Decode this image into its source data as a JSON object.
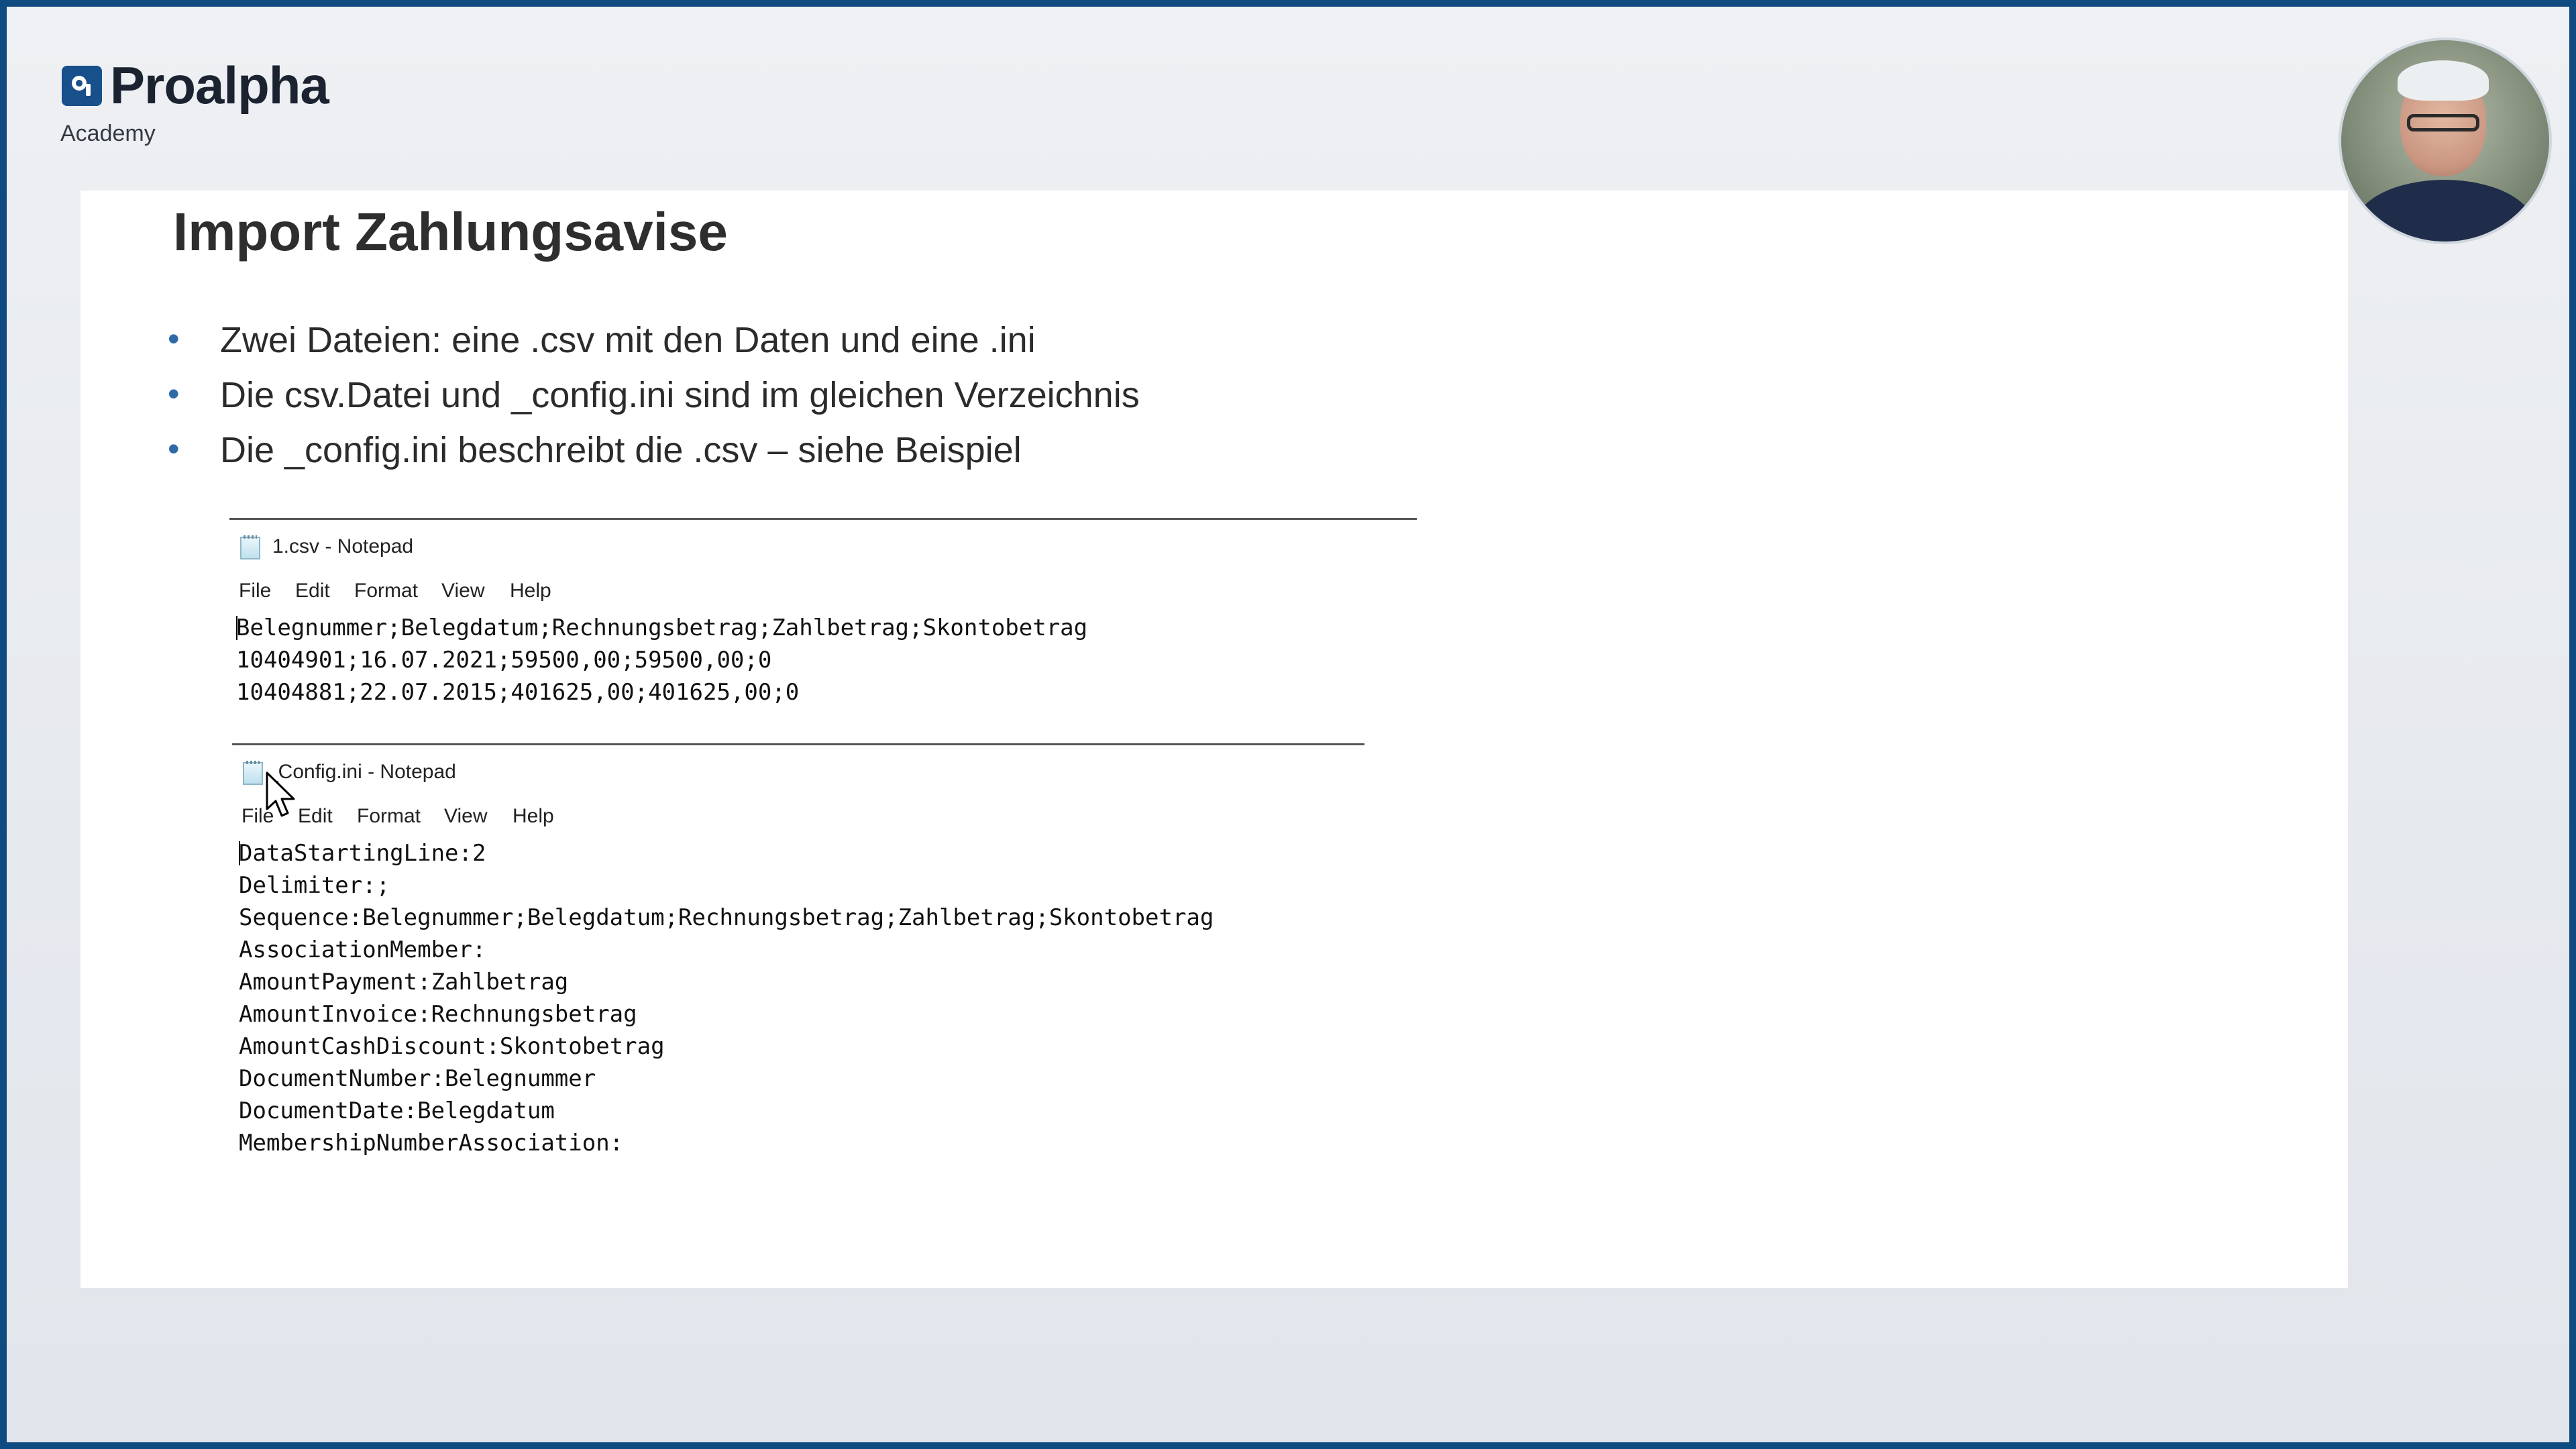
{
  "brand": {
    "name": "Proalpha",
    "sub": "Academy"
  },
  "slide": {
    "title": "Import Zahlungsavise",
    "bullets": [
      "Zwei Dateien: eine .csv mit den Daten und eine .ini",
      "Die csv.Datei und _config.ini sind im gleichen Verzeichnis",
      "Die _config.ini beschreibt die .csv – siehe Beispiel"
    ]
  },
  "notepad_csv": {
    "title": "1.csv - Notepad",
    "menu": [
      "File",
      "Edit",
      "Format",
      "View",
      "Help"
    ],
    "lines": [
      "Belegnummer;Belegdatum;Rechnungsbetrag;Zahlbetrag;Skontobetrag",
      "10404901;16.07.2021;59500,00;59500,00;0",
      "10404881;22.07.2015;401625,00;401625,00;0"
    ]
  },
  "notepad_ini": {
    "title": "_Config.ini - Notepad",
    "menu": [
      "File",
      "Edit",
      "Format",
      "View",
      "Help"
    ],
    "lines": [
      "DataStartingLine:2",
      "Delimiter:;",
      "Sequence:Belegnummer;Belegdatum;Rechnungsbetrag;Zahlbetrag;Skontobetrag",
      "AssociationMember:",
      "AmountPayment:Zahlbetrag",
      "AmountInvoice:Rechnungsbetrag",
      "AmountCashDiscount:Skontobetrag",
      "DocumentNumber:Belegnummer",
      "DocumentDate:Belegdatum",
      "MembershipNumberAssociation:"
    ]
  },
  "colors": {
    "frame": "#0f4a80",
    "brand": "#17508a",
    "bullet": "#2f6aa8"
  },
  "icons": [
    "proalpha-logo-icon",
    "notepad-icon",
    "mouse-cursor-icon"
  ]
}
